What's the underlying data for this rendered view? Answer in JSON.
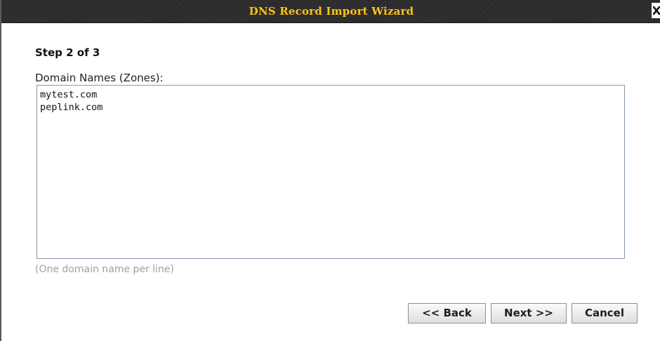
{
  "dialog": {
    "title": "DNS Record Import Wizard",
    "close_icon": "close-icon"
  },
  "step": {
    "label": "Step 2 of 3"
  },
  "zones": {
    "label": "Domain Names (Zones):",
    "value": "mytest.com\npeplink.com",
    "hint": "(One domain name per line)"
  },
  "buttons": {
    "back": "<< Back",
    "next": "Next >>",
    "cancel": "Cancel"
  },
  "colors": {
    "title_text": "#ffc21a",
    "title_bar": "#2f2f2f",
    "hint_text": "#a0a0a0",
    "field_border": "#8a9ab0"
  }
}
